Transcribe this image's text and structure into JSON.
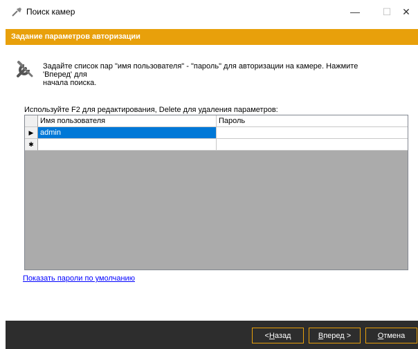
{
  "window": {
    "title": "Поиск камер",
    "controls": {
      "minimize": "—",
      "maximize": "☐",
      "close": "✕"
    }
  },
  "banner": {
    "title": "Задание параметров авторизации"
  },
  "description": {
    "line1": "Задайте список пар \"имя пользователя\" - \"пароль\" для авторизации на камере. Нажмите 'Вперед' для",
    "line2": "начала поиска."
  },
  "grid": {
    "hint": "Используйте F2 для редактирования, Delete для удаления параметров:",
    "columns": [
      "Имя пользователя",
      "Пароль"
    ],
    "rows": [
      {
        "marker": "▶",
        "username": "admin",
        "password": "",
        "selected": true
      },
      {
        "marker": "✱",
        "username": "",
        "password": "",
        "selected": false
      }
    ]
  },
  "link": {
    "text": "Показать пароли по умолчанию"
  },
  "buttons": {
    "back": {
      "prefix": "< ",
      "accel": "Н",
      "rest": "азад"
    },
    "next": {
      "accel": "В",
      "rest": "перед >"
    },
    "cancel": {
      "accel": "О",
      "rest": "тмена"
    }
  },
  "colors": {
    "accent": "#e8a00b",
    "bottom_bar": "#2d2d2d",
    "selection": "#0078d7",
    "link": "#0000ff"
  }
}
